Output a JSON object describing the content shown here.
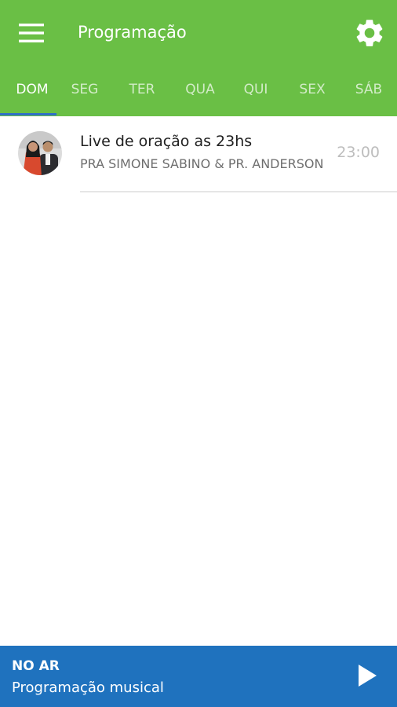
{
  "header": {
    "title": "Programação",
    "menu_icon": "hamburger-menu-icon",
    "settings_icon": "gear-icon",
    "background_color": "#6abf45"
  },
  "tabs": [
    {
      "label": "DOM",
      "active": true
    },
    {
      "label": "SEG",
      "active": false
    },
    {
      "label": "TER",
      "active": false
    },
    {
      "label": "QUA",
      "active": false
    },
    {
      "label": "QUI",
      "active": false
    },
    {
      "label": "SEX",
      "active": false
    },
    {
      "label": "SÁB",
      "active": false
    }
  ],
  "tab_indicator_color": "#2f6fc7",
  "schedule": [
    {
      "title": "Live de oração as 23hs",
      "hosts": "PRA SIMONE SABINO & PR. ANDERSON",
      "time": "23:00"
    }
  ],
  "now_playing": {
    "label": "NO AR",
    "title": "Programação musical",
    "play_icon": "play-icon",
    "background_color": "#1f72be"
  }
}
